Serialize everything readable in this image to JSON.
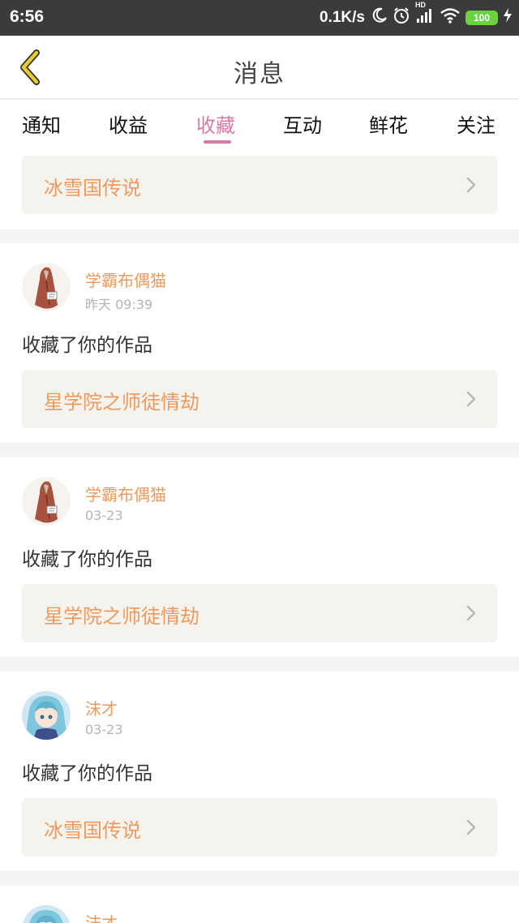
{
  "status_bar": {
    "time": "6:56",
    "speed": "0.1K/s",
    "hd": "HD",
    "battery": "100",
    "icons": [
      "moon-icon",
      "alarm-icon",
      "signal-icon",
      "wifi-icon",
      "battery-icon",
      "charging-icon"
    ]
  },
  "header": {
    "title": "消息",
    "back_icon": "chevron-left-icon"
  },
  "colors": {
    "accent": "#d77aa7",
    "work_title": "#ed9a5e",
    "username": "#ed9a5e",
    "link_bg": "#f4f3ee",
    "back_icon": "#e9cc2b"
  },
  "tabs": [
    {
      "label": "通知"
    },
    {
      "label": "收益"
    },
    {
      "label": "收藏",
      "active": true
    },
    {
      "label": "互动"
    },
    {
      "label": "鲜花"
    },
    {
      "label": "关注"
    }
  ],
  "cards": [
    {
      "work": "冰雪国传说"
    },
    {
      "user": "学霸布偶猫",
      "time": "昨天 09:39",
      "action": "收藏了你的作品",
      "work": "星学院之师徒情劫",
      "avatar": "avatar-figure-brown"
    },
    {
      "user": "学霸布偶猫",
      "time": "03-23",
      "action": "收藏了你的作品",
      "work": "星学院之师徒情劫",
      "avatar": "avatar-figure-brown"
    },
    {
      "user": "沫才",
      "time": "03-23",
      "action": "收藏了你的作品",
      "work": "冰雪国传说",
      "avatar": "avatar-anime-blue"
    },
    {
      "user": "沫才"
    }
  ]
}
